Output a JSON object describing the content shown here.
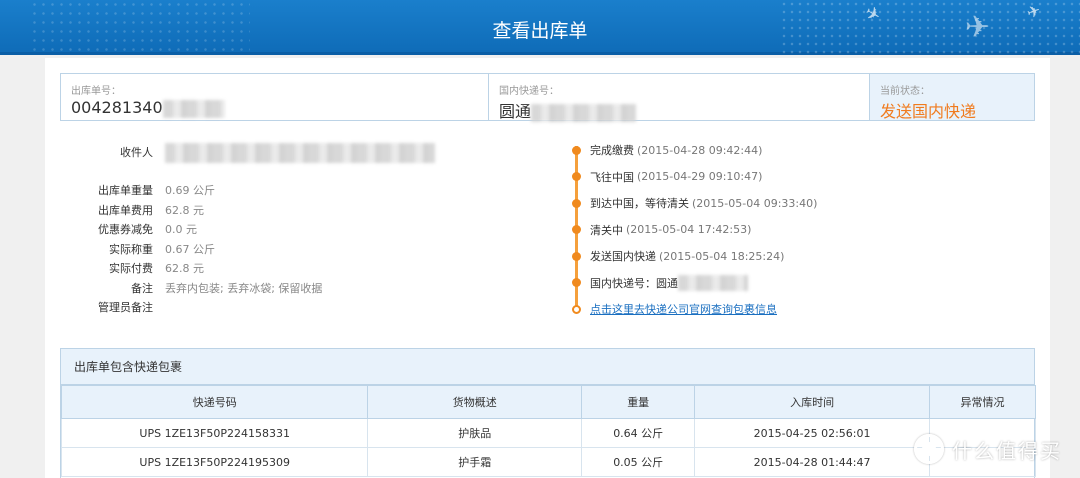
{
  "header": {
    "title": "查看出库单"
  },
  "info_bar": {
    "order_no_label": "出库单号：",
    "order_no_value": "004281340",
    "domestic_no_label": "国内快递号：",
    "domestic_no_value": "圆通",
    "status_label": "当前状态：",
    "status_value": "发送国内快递"
  },
  "details": [
    {
      "key": "收件人",
      "value": ""
    },
    {
      "key": "出库单重量",
      "value": "0.69 公斤"
    },
    {
      "key": "出库单费用",
      "value": "62.8 元"
    },
    {
      "key": "优惠券减免",
      "value": "0.0 元"
    },
    {
      "key": "实际称重",
      "value": "0.67 公斤"
    },
    {
      "key": "实际付费",
      "value": "62.8 元"
    },
    {
      "key": "备注",
      "value": "丢弃内包装; 丢弃冰袋; 保留收据"
    },
    {
      "key": "管理员备注",
      "value": ""
    }
  ],
  "timeline": [
    {
      "event": "完成缴费",
      "time": "(2015-04-28 09:42:44)"
    },
    {
      "event": "飞往中国",
      "time": "(2015-04-29 09:10:47)"
    },
    {
      "event": "到达中国，等待清关",
      "time": "(2015-05-04 09:33:40)"
    },
    {
      "event": "清关中",
      "time": "(2015-05-04 17:42:53)"
    },
    {
      "event": "发送国内快递",
      "time": "(2015-05-04 18:25:24)"
    },
    {
      "event": "国内快递号：圆通",
      "time": ""
    }
  ],
  "timeline_link": "点击这里去快递公司官网查询包裹信息",
  "packages": {
    "title": "出库单包含快递包裹",
    "columns": [
      "快递号码",
      "货物概述",
      "重量",
      "入库时间",
      "异常情况"
    ],
    "rows": [
      [
        "UPS 1ZE13F50P224158331",
        "护肤品",
        "0.64 公斤",
        "2015-04-25 02:56:01",
        ""
      ],
      [
        "UPS 1ZE13F50P224195309",
        "护手霜",
        "0.05 公斤",
        "2015-04-28 01:44:47",
        ""
      ]
    ]
  },
  "watermark": {
    "text": "什么值得买",
    "icon": "smzdm-logo-icon"
  }
}
